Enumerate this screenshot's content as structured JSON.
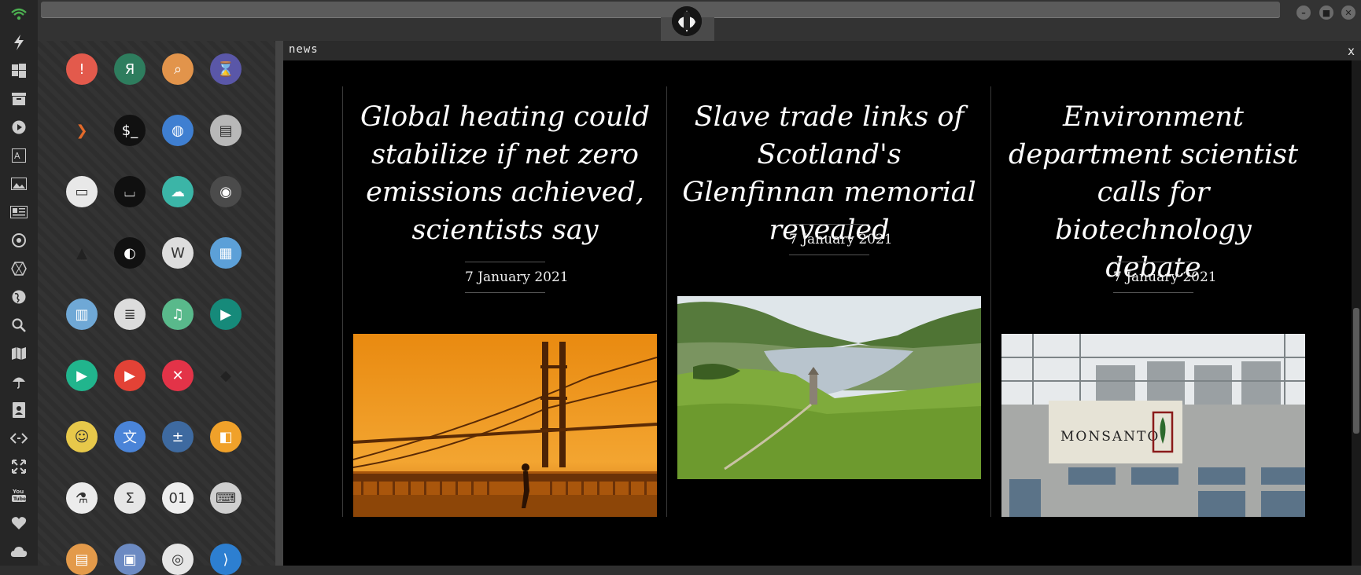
{
  "window": {
    "title": "news",
    "close_label": "x"
  },
  "dock": {
    "icons": [
      "wifi-icon",
      "lightning-icon",
      "windows-icon",
      "archive-icon",
      "play-icon",
      "translate-icon",
      "image-icon",
      "news-icon",
      "settings-icon",
      "hexagon-icon",
      "globe-icon",
      "search-icon",
      "map-icon",
      "umbrella-icon",
      "contacts-icon",
      "code-icon",
      "expand-icon",
      "youtube-icon",
      "heart-icon",
      "cloud-icon"
    ]
  },
  "launcher": {
    "apps": [
      {
        "name": "warning-app-icon",
        "glyph": "!",
        "bg": "#e35a4c"
      },
      {
        "name": "yandex-app-icon",
        "glyph": "Я",
        "bg": "#2e7d5e"
      },
      {
        "name": "search-app-icon",
        "glyph": "⌕",
        "bg": "#e2944b"
      },
      {
        "name": "hourglass-app-icon",
        "glyph": "⌛",
        "bg": "#5a57a8"
      },
      {
        "name": "arrow-app-icon",
        "glyph": "❯",
        "bg": "transparent"
      },
      {
        "name": "terminal-app-icon",
        "glyph": "$_",
        "bg": "#111111"
      },
      {
        "name": "globe-app-icon",
        "glyph": "◍",
        "bg": "#3f7fd1"
      },
      {
        "name": "drive-app-icon",
        "glyph": "▤",
        "bg": "#b8b8b8"
      },
      {
        "name": "window-app-icon",
        "glyph": "▭",
        "bg": "#e8e8e8"
      },
      {
        "name": "bracket-app-icon",
        "glyph": "⌴",
        "bg": "#101010"
      },
      {
        "name": "cloud-lock-app-icon",
        "glyph": "☁",
        "bg": "#3bb5a7"
      },
      {
        "name": "github-app-icon",
        "glyph": "◉",
        "bg": "#4b4b4b"
      },
      {
        "name": "star-trek-app-icon",
        "glyph": "▲",
        "bg": "transparent"
      },
      {
        "name": "death-star-app-icon",
        "glyph": "◐",
        "bg": "#111111"
      },
      {
        "name": "wikipedia-app-icon",
        "glyph": "W",
        "bg": "#dddddd"
      },
      {
        "name": "world-map-app-icon",
        "glyph": "▦",
        "bg": "#5ca0d8"
      },
      {
        "name": "books-app-icon",
        "glyph": "▥",
        "bg": "#6fa8d6"
      },
      {
        "name": "notes-app-icon",
        "glyph": "≣",
        "bg": "#dcdcdc"
      },
      {
        "name": "music-app-icon",
        "glyph": "♫",
        "bg": "#59b98b"
      },
      {
        "name": "video-app-icon",
        "glyph": "▶",
        "bg": "#168a7a"
      },
      {
        "name": "player-app-icon",
        "glyph": "▶",
        "bg": "#21b58d"
      },
      {
        "name": "youtube-app-icon",
        "glyph": "▶",
        "bg": "#e34236"
      },
      {
        "name": "close-app-icon",
        "glyph": "✕",
        "bg": "#e33348"
      },
      {
        "name": "ironman-app-icon",
        "glyph": "◆",
        "bg": "transparent"
      },
      {
        "name": "c3po-app-icon",
        "glyph": "☺",
        "bg": "#e7c84a"
      },
      {
        "name": "translate-app-icon",
        "glyph": "文",
        "bg": "#4a84d8"
      },
      {
        "name": "calculator-app-icon",
        "glyph": "±",
        "bg": "#3e6aa0"
      },
      {
        "name": "color-app-icon",
        "glyph": "◧",
        "bg": "#f0a12a"
      },
      {
        "name": "science-app-icon",
        "glyph": "⚗",
        "bg": "#ececec"
      },
      {
        "name": "sigma-app-icon",
        "glyph": "Σ",
        "bg": "#e6e6e6"
      },
      {
        "name": "binary-app-icon",
        "glyph": "01",
        "bg": "#eeeeee"
      },
      {
        "name": "keyboard-app-icon",
        "glyph": "⌨",
        "bg": "#cfcfcf"
      },
      {
        "name": "document-app-icon",
        "glyph": "▤",
        "bg": "#e39a4a"
      },
      {
        "name": "gallery-app-icon",
        "glyph": "▣",
        "bg": "#6c8ac2"
      },
      {
        "name": "presentation-app-icon",
        "glyph": "◎",
        "bg": "#e6e6e6"
      },
      {
        "name": "vscode-app-icon",
        "glyph": "⟩",
        "bg": "#2d7fd1"
      }
    ]
  },
  "articles": [
    {
      "headline": "Global heating could stabilize if net zero emissions achieved, scientists say",
      "date": "7 January 2021"
    },
    {
      "headline": "Slave trade links of Scotland's Glenfinnan memorial revealed",
      "date": "7 January 2021"
    },
    {
      "headline": "Environment department scientist calls for biotechnology debate",
      "date": "7 January 2021"
    }
  ],
  "images": {
    "monsanto_sign": "MONSANTO"
  }
}
